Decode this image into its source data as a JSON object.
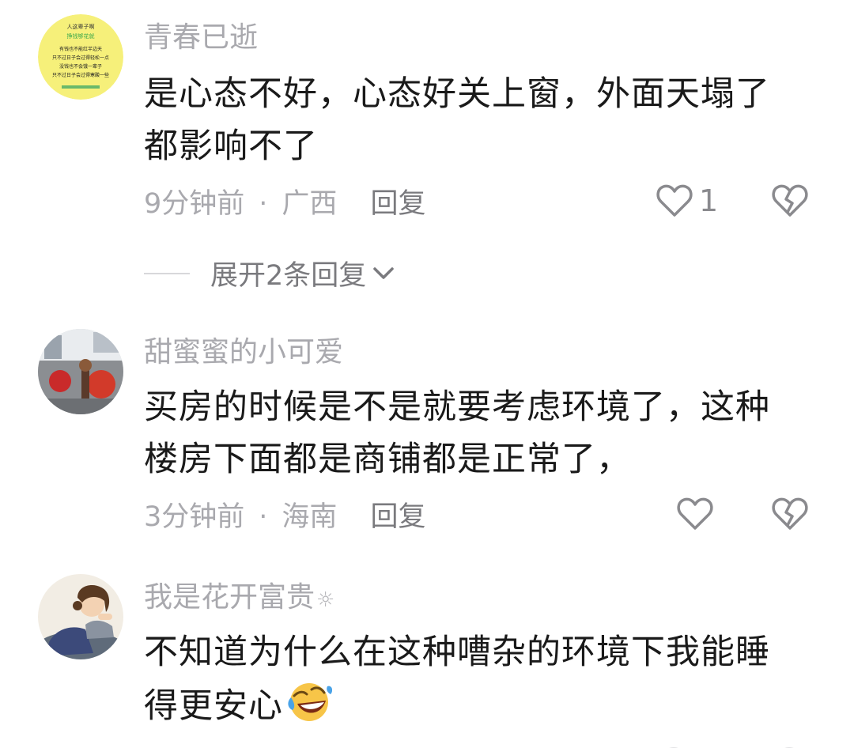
{
  "colors": {
    "username": "#a9a9ae",
    "content": "#1a1a1a",
    "meta": "#a9a9ae",
    "icon": "#8a8a8e",
    "background": "#ffffff"
  },
  "comments": [
    {
      "username": "青春已逝",
      "avatar_text": [
        "人这辈子啊",
        "挣钱够花就",
        "有钱也不能红半边天",
        "只不过日子会过得轻松一点",
        "没钱也不会饿一辈子",
        "只不过日子会过得寒酸一些"
      ],
      "text": "是心态不好，心态好关上窗，外面天塌了都影响不了",
      "time": "9分钟前",
      "location": "广西",
      "reply_label": "回复",
      "like_count": "1",
      "expand_label": "展开2条回复"
    },
    {
      "username": "甜蜜蜜的小可爱",
      "text": "买房的时候是不是就要考虑环境了，这种楼房下面都是商铺都是正常了，",
      "time": "3分钟前",
      "location": "海南",
      "reply_label": "回复",
      "like_count": ""
    },
    {
      "username": "我是花开富贵",
      "username_suffix_icon": "sun-icon",
      "text": "不知道为什么在这种嘈杂的环境下我能睡得更安心",
      "emoji": "rolling-laughing-emoji"
    }
  ]
}
